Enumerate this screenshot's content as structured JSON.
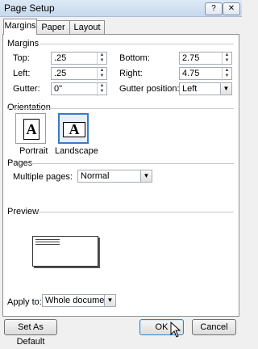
{
  "window": {
    "title": "Page Setup",
    "help_label": "?",
    "close_label": "✕"
  },
  "tabs": [
    {
      "label": "Margins",
      "active": true
    },
    {
      "label": "Paper",
      "active": false
    },
    {
      "label": "Layout",
      "active": false
    }
  ],
  "margins": {
    "section_label": "Margins",
    "top": {
      "label": "Top:",
      "value": ".25"
    },
    "bottom": {
      "label": "Bottom:",
      "value": "2.75"
    },
    "left": {
      "label": "Left:",
      "value": ".25"
    },
    "right": {
      "label": "Right:",
      "value": "4.75"
    },
    "gutter": {
      "label": "Gutter:",
      "value": "0\""
    },
    "gutter_position": {
      "label": "Gutter position:",
      "value": "Left"
    }
  },
  "orientation": {
    "section_label": "Orientation",
    "portrait_label": "Portrait",
    "landscape_label": "Landscape",
    "glyph": "A"
  },
  "pages": {
    "section_label": "Pages",
    "multiple_pages_label": "Multiple pages:",
    "multiple_pages_value": "Normal"
  },
  "preview": {
    "section_label": "Preview"
  },
  "apply_to": {
    "label": "Apply to:",
    "value": "Whole document"
  },
  "buttons": {
    "set_as_default": "Set As Default",
    "ok": "OK",
    "cancel": "Cancel"
  },
  "colors": {
    "accent": "#3b79c9",
    "titlebar": "#c7d9ee"
  }
}
